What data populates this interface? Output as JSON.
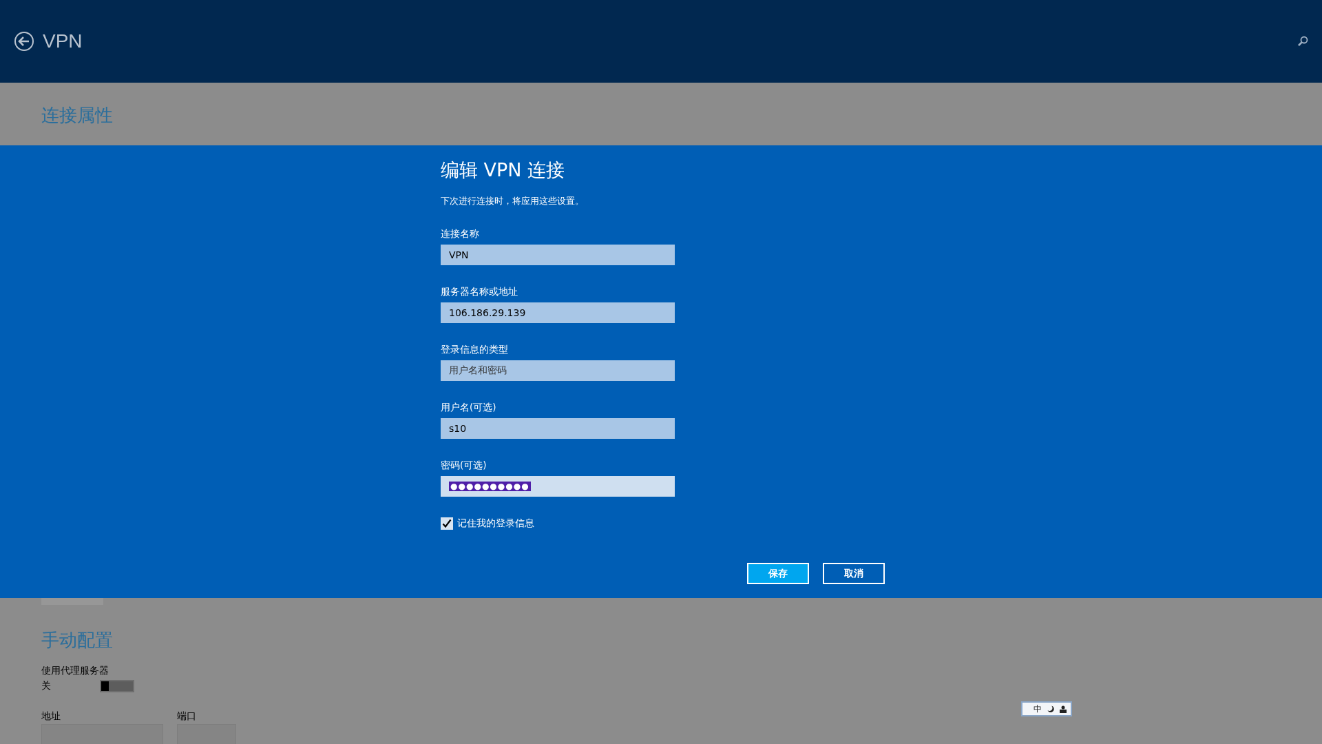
{
  "header": {
    "title": "VPN"
  },
  "background_top": {
    "section_title": "连接属性"
  },
  "dialog": {
    "title": "编辑 VPN 连接",
    "subtitle": "下次进行连接时，将应用这些设置。",
    "fields": [
      {
        "kind": "text",
        "label": "连接名称",
        "value": "VPN",
        "focused": false
      },
      {
        "kind": "text",
        "label": "服务器名称或地址",
        "value": "106.186.29.139",
        "focused": false
      },
      {
        "kind": "select",
        "label": "登录信息的类型",
        "value": "用户名和密码",
        "focused": false
      },
      {
        "kind": "text",
        "label": "用户名(可选)",
        "value": "s10",
        "focused": false
      },
      {
        "kind": "password",
        "label": "密码(可选)",
        "value": "●●●●●●●●●●",
        "focused": true,
        "text_selected": true
      }
    ],
    "remember": {
      "label": "记住我的登录信息",
      "checked": true
    },
    "buttons": [
      {
        "label": "保存",
        "primary": true
      },
      {
        "label": "取消",
        "primary": false
      }
    ]
  },
  "background_bottom": {
    "section_title": "手动配置",
    "proxy": {
      "label": "使用代理服务器",
      "state_text": "关",
      "on": false
    },
    "address_label": "地址",
    "port_label": "端口"
  },
  "ime_bar": {
    "mode": "中"
  }
}
